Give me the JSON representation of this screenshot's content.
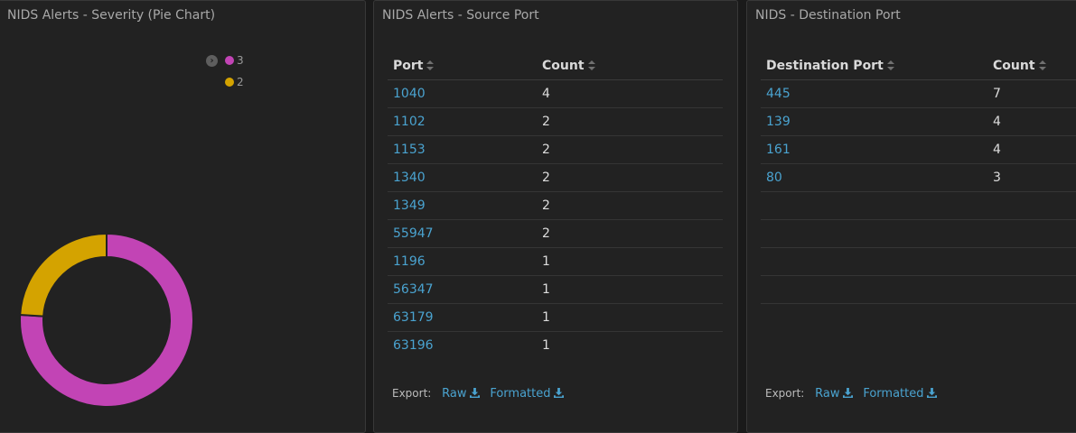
{
  "pie_panel": {
    "title": "NIDS Alerts - Severity (Pie Chart)",
    "legend_toggle_icon": "chevron-right-icon",
    "legend": [
      {
        "label": "3",
        "color": "#c244b5"
      },
      {
        "label": "2",
        "color": "#d4a300"
      }
    ]
  },
  "chart_data": {
    "type": "pie",
    "donut": true,
    "categories": [
      "3",
      "2"
    ],
    "values": [
      19,
      6
    ],
    "colors": [
      "#c244b5",
      "#d4a300"
    ],
    "title": "NIDS Alerts - Severity (Pie Chart)",
    "legend_position": "top-right"
  },
  "source_port_panel": {
    "title": "NIDS Alerts - Source Port",
    "columns": [
      "Port",
      "Count"
    ],
    "rows": [
      {
        "port": "1040",
        "count": "4"
      },
      {
        "port": "1102",
        "count": "2"
      },
      {
        "port": "1153",
        "count": "2"
      },
      {
        "port": "1340",
        "count": "2"
      },
      {
        "port": "1349",
        "count": "2"
      },
      {
        "port": "55947",
        "count": "2"
      },
      {
        "port": "1196",
        "count": "1"
      },
      {
        "port": "56347",
        "count": "1"
      },
      {
        "port": "63179",
        "count": "1"
      },
      {
        "port": "63196",
        "count": "1"
      }
    ],
    "export": {
      "label": "Export:",
      "raw": "Raw",
      "formatted": "Formatted"
    }
  },
  "dest_port_panel": {
    "title": "NIDS - Destination Port",
    "columns": [
      "Destination Port",
      "Count"
    ],
    "rows": [
      {
        "port": "445",
        "count": "7"
      },
      {
        "port": "139",
        "count": "4"
      },
      {
        "port": "161",
        "count": "4"
      },
      {
        "port": "80",
        "count": "3"
      }
    ],
    "export": {
      "label": "Export:",
      "raw": "Raw",
      "formatted": "Formatted"
    }
  }
}
